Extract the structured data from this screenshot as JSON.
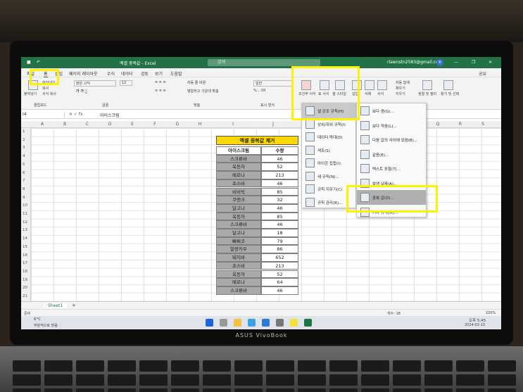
{
  "window": {
    "title": "엑셀 중복값 - Excel",
    "search": "검색",
    "account": "rlawnstn2583@gmail.com",
    "avatar": "R"
  },
  "menubar": {
    "tabs": [
      "파일",
      "홈",
      "삽입",
      "페이지 레이아웃",
      "수식",
      "데이터",
      "검토",
      "보기",
      "도움말"
    ],
    "share": "공유"
  },
  "ribbon": {
    "font_name": "맑은 고딕",
    "font_size": "12",
    "groups": [
      "클립보드",
      "글꼴",
      "맞춤",
      "표시 형식"
    ],
    "paste": "붙여넣기",
    "cut": "잘라내기",
    "copy": "복사",
    "format_painter": "서식 복사",
    "wrap": "자동 줄 바꿈",
    "merge": "병합하고 가운데 맞춤",
    "number_format": "일반",
    "cond_format": "조건부 서식",
    "table_format": "표 서식",
    "cell_style": "셀 스타일",
    "insert": "삽입",
    "delete": "삭제",
    "format": "서식",
    "autosum": "자동 합계",
    "fill": "채우기",
    "clear": "지우기",
    "sort": "정렬 및 필터",
    "find": "찾기 및 선택"
  },
  "formula_bar": {
    "cell": "I4",
    "value": "아이스크림"
  },
  "columns": [
    "A",
    "B",
    "C",
    "D",
    "E",
    "F",
    "G",
    "H",
    "I",
    "J",
    "K",
    "L",
    "M",
    "N",
    "O",
    "P",
    "Q",
    "R",
    "S"
  ],
  "rows": [
    "1",
    "2",
    "3",
    "4",
    "5",
    "6",
    "7",
    "8",
    "9",
    "10",
    "11",
    "12",
    "13",
    "14",
    "15",
    "16",
    "17",
    "18",
    "19",
    "20",
    "21"
  ],
  "table": {
    "title": "엑셀 중복값 제거",
    "headers": [
      "아이스크림",
      "수량"
    ],
    "rows": [
      [
        "스크류바",
        "46"
      ],
      [
        "옥동자",
        "52"
      ],
      [
        "메로나",
        "213"
      ],
      [
        "죠스바",
        "46"
      ],
      [
        "비비빅",
        "85"
      ],
      [
        "쿠앤크",
        "32"
      ],
      [
        "달고나",
        "46"
      ],
      [
        "옥동자",
        "85"
      ],
      [
        "스크류바",
        "46"
      ],
      [
        "달고나",
        "18"
      ],
      [
        "빠삐코",
        "79"
      ],
      [
        "말랑카우",
        "86"
      ],
      [
        "돼지바",
        "652"
      ],
      [
        "죠스바",
        "213"
      ],
      [
        "옥동자",
        "52"
      ],
      [
        "메로나",
        "64"
      ],
      [
        "스크류바",
        "46"
      ]
    ]
  },
  "cond_menu": {
    "items": [
      "셀 강조 규칙(H)",
      "상위/하위 규칙(I)",
      "데이터 막대(D)",
      "색조(S)",
      "아이콘 집합(I)",
      "새 규칙(N)...",
      "규칙 지우기(C)",
      "규칙 관리(R)..."
    ]
  },
  "sub_menu": {
    "items": [
      "보다 큼(G)...",
      "보다 작음(L)...",
      "다음 값의 사이에 있음(B)...",
      "같음(E)...",
      "텍스트 포함(T)...",
      "발생 날짜(A)...",
      "중복 값(D)...",
      "기타 규칙(M)..."
    ]
  },
  "sheet": {
    "tab": "Sheet1",
    "add": "+"
  },
  "status": {
    "ready": "준비",
    "count": "개수: 18",
    "zoom": "100%"
  },
  "taskbar": {
    "temp": "6°C",
    "weather": "부분적으로 맑음",
    "time": "오후 5:45",
    "date": "2024-02-10"
  },
  "laptop": {
    "brand": "ASUS VivoBook"
  },
  "colors": {
    "excel_green": "#217346",
    "highlight_yellow": "#fff200",
    "title_yellow": "#ffd800"
  }
}
